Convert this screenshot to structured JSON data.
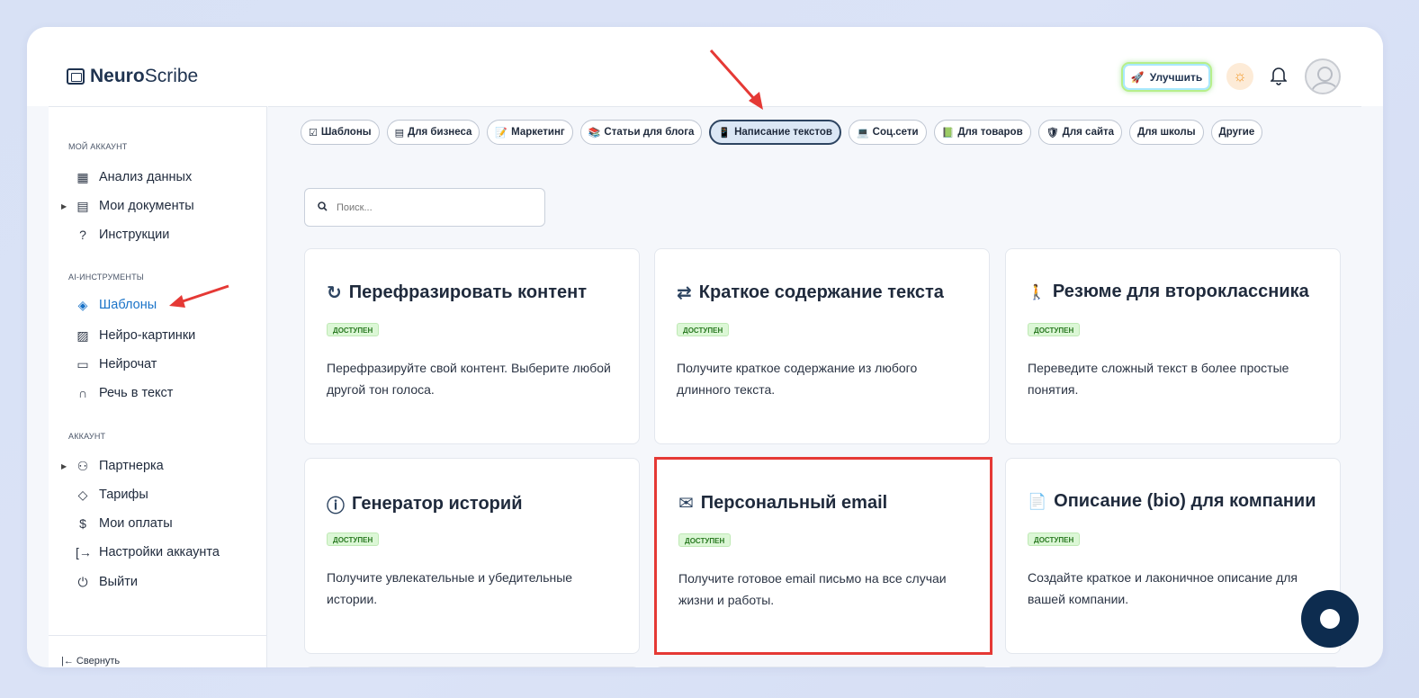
{
  "app": {
    "logo_bold": "Neuro",
    "logo_rest": "Scribe"
  },
  "header": {
    "upgrade_label": "Улучшить",
    "upgrade_icon": "rocket-icon",
    "theme_icon": "sun-icon",
    "notifications_icon": "bell-icon"
  },
  "sidebar": {
    "section_account": "МОЙ АККАУНТ",
    "items_account": [
      {
        "label": "Анализ данных",
        "icon": "grid-icon"
      },
      {
        "label": "Мои документы",
        "icon": "document-icon"
      },
      {
        "label": "Инструкции",
        "icon": "help-icon"
      }
    ],
    "section_ai": "AI-ИНСТРУМЕНТЫ",
    "items_ai": [
      {
        "label": "Шаблоны",
        "icon": "layers-icon",
        "active": true
      },
      {
        "label": "Нейро-картинки",
        "icon": "image-icon"
      },
      {
        "label": "Нейрочат",
        "icon": "chat-icon"
      },
      {
        "label": "Речь в текст",
        "icon": "headphones-icon"
      }
    ],
    "section_acc": "АККАУНТ",
    "items_acc": [
      {
        "label": "Партнерка",
        "icon": "users-icon"
      },
      {
        "label": "Тарифы",
        "icon": "tag-icon"
      },
      {
        "label": "Мои оплаты",
        "icon": "dollar-icon"
      },
      {
        "label": "Настройки аккаунта",
        "icon": "login-icon"
      },
      {
        "label": "Выйти",
        "icon": "power-icon"
      }
    ],
    "collapse_label": "Свернуть"
  },
  "categories": [
    {
      "label": "Шаблоны",
      "emoji": "☑"
    },
    {
      "label": "Для бизнеса",
      "emoji": "▤"
    },
    {
      "label": "Маркетинг",
      "emoji": "📝"
    },
    {
      "label": "Статьи для блога",
      "emoji": "📚"
    },
    {
      "label": "Написание текстов",
      "emoji": "📱",
      "active": true
    },
    {
      "label": "Соц.сети",
      "emoji": "💻"
    },
    {
      "label": "Для товаров",
      "emoji": "📗"
    },
    {
      "label": "Для сайта",
      "emoji": "🛡"
    },
    {
      "label": "Для школы",
      "emoji": ""
    },
    {
      "label": "Другие",
      "emoji": ""
    }
  ],
  "search": {
    "placeholder": "Поиск..."
  },
  "cards": [
    {
      "title": "Перефразировать контент",
      "icon": "↻",
      "badge": "ДОСТУПЕН",
      "desc": "Перефразируйте свой контент. Выберите любой другой тон голоса."
    },
    {
      "title": "Краткое содержание текста",
      "icon": "⇄",
      "badge": "ДОСТУПЕН",
      "desc": "Получите краткое содержание из любого длинного текста."
    },
    {
      "title": "Резюме для второклассника",
      "icon": "🚶",
      "badge": "ДОСТУПЕН",
      "desc": "Переведите сложный текст в более простые понятия."
    },
    {
      "title": "Генератор историй",
      "icon": "ⓘ",
      "badge": "ДОСТУПЕН",
      "desc": "Получите увлекательные и убедительные истории."
    },
    {
      "title": "Персональный email",
      "icon": "✉",
      "badge": "ДОСТУПЕН",
      "desc": "Получите готовое email письмо на все случаи жизни и работы."
    },
    {
      "title": "Описание (bio) для компании",
      "icon": "📄",
      "badge": "ДОСТУПЕН",
      "desc": "Создайте краткое и лаконичное описание для вашей компании."
    }
  ],
  "colors": {
    "accent": "#1a73c8",
    "annotation": "#e53935",
    "badge_bg": "#dcf7d6"
  }
}
